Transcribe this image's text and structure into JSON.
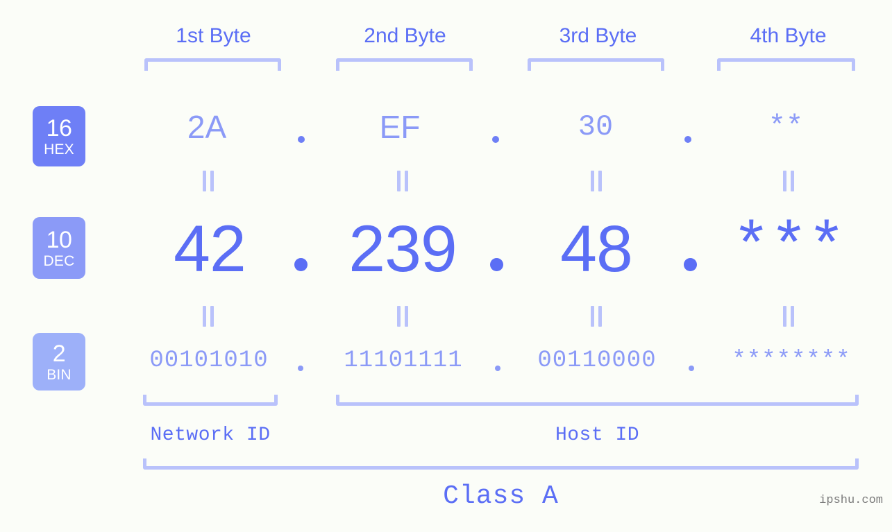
{
  "meta": {
    "watermark": "ipshu.com",
    "background_color": "#fbfdf8",
    "accent_color": "#5b6ef5",
    "accent_light_color": "#8b9af7",
    "bracket_color": "#b9c2fb"
  },
  "byte_headers": [
    {
      "label": "1st Byte"
    },
    {
      "label": "2nd Byte"
    },
    {
      "label": "3rd Byte"
    },
    {
      "label": "4th Byte"
    }
  ],
  "bases": [
    {
      "num": "16",
      "name": "HEX",
      "color": "#6e7ff6"
    },
    {
      "num": "10",
      "name": "DEC",
      "color": "#8b9af7"
    },
    {
      "num": "2",
      "name": "BIN",
      "color": "#9db0f9"
    }
  ],
  "rows": {
    "hex": {
      "values": [
        "2A",
        "EF",
        "30",
        "**"
      ],
      "separator": "."
    },
    "dec": {
      "values": [
        "42",
        "239",
        "48",
        "***"
      ],
      "separator": "."
    },
    "bin": {
      "values": [
        "00101010",
        "11101111",
        "00110000",
        "********"
      ],
      "separator": "."
    }
  },
  "equality_mark": "||",
  "regions": [
    {
      "label": "Network ID"
    },
    {
      "label": "Host ID"
    }
  ],
  "class": {
    "label": "Class A"
  }
}
